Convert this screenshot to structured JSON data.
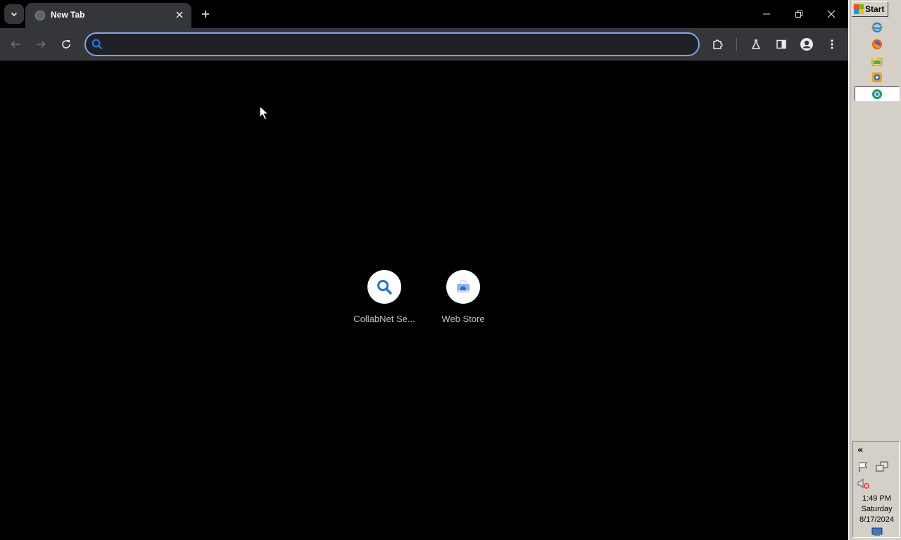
{
  "browser": {
    "tab": {
      "title": "New Tab"
    },
    "omnibox": {
      "value": "",
      "placeholder": ""
    },
    "shortcuts": [
      {
        "label": "CollabNet Se...",
        "icon": "search-icon"
      },
      {
        "label": "Web Store",
        "icon": "web-store-icon"
      }
    ]
  },
  "taskbar": {
    "start_label": "Start",
    "clock": {
      "time": "1:49 PM",
      "day": "Saturday",
      "date": "8/17/2024"
    },
    "tray_chevron": "«"
  },
  "colors": {
    "accent": "#7aa7f5",
    "toolbar": "#35363a",
    "taskbar": "#d4d0c8",
    "search_icon_blue": "#1a73e8"
  }
}
